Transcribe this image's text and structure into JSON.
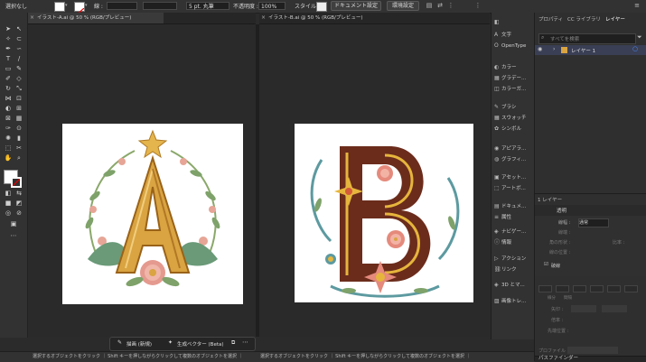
{
  "control_bar": {
    "selection_label": "選択なし",
    "stroke_label": "線 :",
    "brush_label": "5 pt. 丸筆",
    "opacity_label": "不透明度 :",
    "opacity_value": "100%",
    "style_label": "スタイル :",
    "doc_setup_button": "ドキュメント設定",
    "prefs_button": "環境設定"
  },
  "tabs": [
    {
      "label": "イラスト-A.ai @ 50 % (RGB/プレビュー)"
    },
    {
      "label": "イラスト-B.ai @ 50 % (RGB/プレビュー)"
    }
  ],
  "artwork": [
    {
      "letter": "A",
      "colors": {
        "gold": "#d9a441",
        "leaf": "#6a9a78",
        "pink": "#e59a8f"
      }
    },
    {
      "letter": "B",
      "colors": {
        "brown": "#6b2c1c",
        "gold": "#e6b53c",
        "teal": "#5c9aa0",
        "pink": "#e58a7c"
      }
    }
  ],
  "context_task_bar": {
    "draw_button": "描画 (新規)",
    "gen_vector_button": "生成ベクター (Beta)"
  },
  "status_bar": {
    "left_text": "選択するオブジェクトをクリック ｜ Shift キーを押しながらクリックして複数のオブジェクトを選択 ｜",
    "right_text": "選択するオブジェクトをクリック ｜ Shift キーを押しながらクリックして複数のオブジェクトを選択 ｜"
  },
  "icon_panel": {
    "items": [
      {
        "icon": "adjust-icon",
        "label": ""
      },
      {
        "icon": "text-icon",
        "label": "A",
        "sub": "文字"
      },
      {
        "icon": "opentype-icon",
        "label": "OpenType"
      },
      {
        "icon": "color-icon",
        "label": "カラー"
      },
      {
        "icon": "gradient-icon",
        "label": "グラデー..."
      },
      {
        "icon": "color-guide-icon",
        "label": "カラーガ..."
      },
      {
        "icon": "brush-icon",
        "label": "ブラシ"
      },
      {
        "icon": "swatch-icon",
        "label": "スウォッチ"
      },
      {
        "icon": "symbol-icon",
        "label": "シンボル"
      },
      {
        "icon": "appearance-icon",
        "label": "アピアラ..."
      },
      {
        "icon": "graphic-style-icon",
        "label": "グラフィ..."
      },
      {
        "icon": "asset-icon",
        "label": "アセット..."
      },
      {
        "icon": "artboard-icon",
        "label": "アートボ..."
      },
      {
        "icon": "document-icon",
        "label": "ドキュメ..."
      },
      {
        "icon": "attributes-icon",
        "label": "属性"
      },
      {
        "icon": "navigator-icon",
        "label": "ナビゲー..."
      },
      {
        "icon": "info-icon",
        "label": "情報"
      },
      {
        "icon": "actions-icon",
        "label": "アクション"
      },
      {
        "icon": "link-icon",
        "label": "リンク"
      },
      {
        "icon": "3d-icon",
        "label": "3D とマ..."
      },
      {
        "icon": "image-trace-icon",
        "label": "画像トレ..."
      }
    ]
  },
  "layers_panel": {
    "tabs": [
      "プロパティ",
      "CC ライブラリ",
      "レイヤー"
    ],
    "search_placeholder": "すべてを検索",
    "layer_name": "レイヤー 1",
    "layer_count": "1 レイヤー",
    "transparency_title": "透明",
    "blend_mode": "通常",
    "pathfinder_title": "パスファインダー",
    "labels": {
      "l1": "線幅 :",
      "l2": "線端 :",
      "l3": "角の形状 :",
      "l4": "線の位置 :",
      "ratio": "比率 :",
      "dash": "破線",
      "arrow": "矢印 :",
      "scale": "倍率 :",
      "align": "先端位置 :",
      "profile": "プロファイル :",
      "limit": "比率 :",
      "segment": "線分",
      "gap": "間隔"
    }
  }
}
